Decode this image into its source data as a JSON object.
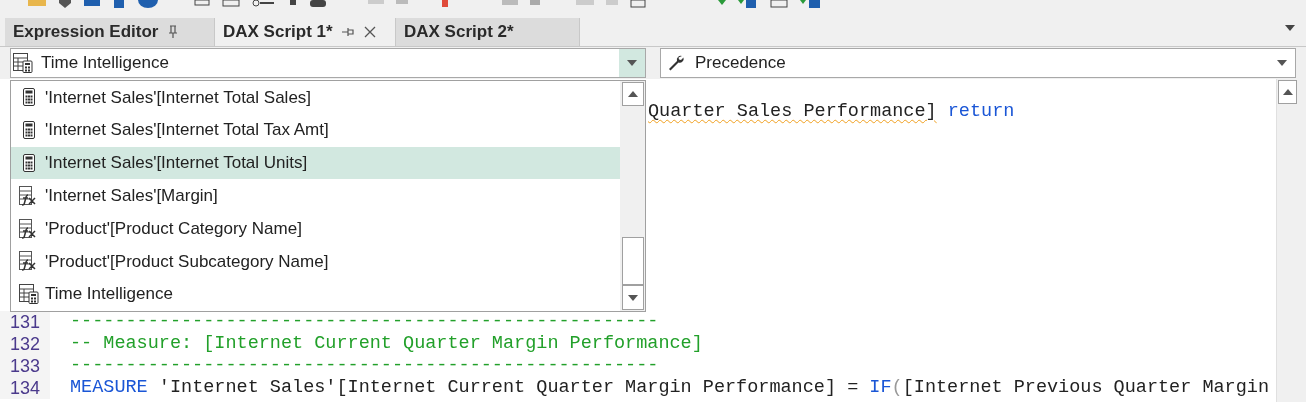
{
  "tabs": [
    {
      "label": "Expression Editor",
      "selected": false,
      "pinned": true,
      "closable": false
    },
    {
      "label": "DAX Script 1*",
      "selected": true,
      "pinned": true,
      "closable": true
    },
    {
      "label": "DAX Script 2*",
      "selected": false,
      "pinned": false,
      "closable": false
    }
  ],
  "object_selector": {
    "value": "Time Intelligence",
    "open": true
  },
  "property_selector": {
    "value": "Precedence"
  },
  "object_list": [
    {
      "kind": "measure",
      "label": "'Internet Sales'[Internet Total Sales]",
      "selected": false
    },
    {
      "kind": "measure",
      "label": "'Internet Sales'[Internet Total Tax Amt]",
      "selected": false
    },
    {
      "kind": "measure",
      "label": "'Internet Sales'[Internet Total Units]",
      "selected": true
    },
    {
      "kind": "column",
      "label": "'Internet Sales'[Margin]",
      "selected": false
    },
    {
      "kind": "column",
      "label": "'Product'[Product Category Name]",
      "selected": false
    },
    {
      "kind": "column",
      "label": "'Product'[Product Subcategory Name]",
      "selected": false
    },
    {
      "kind": "table",
      "label": "Time Intelligence",
      "selected": false
    }
  ],
  "editor": {
    "partial_line": [
      {
        "kind": "plain",
        "text": "Quarter Sales Performance]",
        "flagged": true
      },
      {
        "kind": "keyword",
        "text": " return"
      }
    ],
    "lines": [
      {
        "number": "131",
        "segments": [
          {
            "kind": "comment",
            "text": "-----------------------------------------------------"
          }
        ]
      },
      {
        "number": "132",
        "segments": [
          {
            "kind": "comment",
            "text": "-- Measure: [Internet Current Quarter Margin Performance]"
          }
        ]
      },
      {
        "number": "133",
        "segments": [
          {
            "kind": "comment",
            "text": "-----------------------------------------------------"
          }
        ]
      },
      {
        "number": "134",
        "segments": [
          {
            "kind": "keyword",
            "text": "MEASURE"
          },
          {
            "kind": "plain",
            "text": " 'Internet Sales'[Internet Current Quarter Margin Performance] = "
          },
          {
            "kind": "keyword",
            "text": "IF"
          },
          {
            "kind": "paren",
            "text": "("
          },
          {
            "kind": "plain",
            "text": "[Internet Previous Quarter Margin"
          }
        ]
      }
    ]
  }
}
